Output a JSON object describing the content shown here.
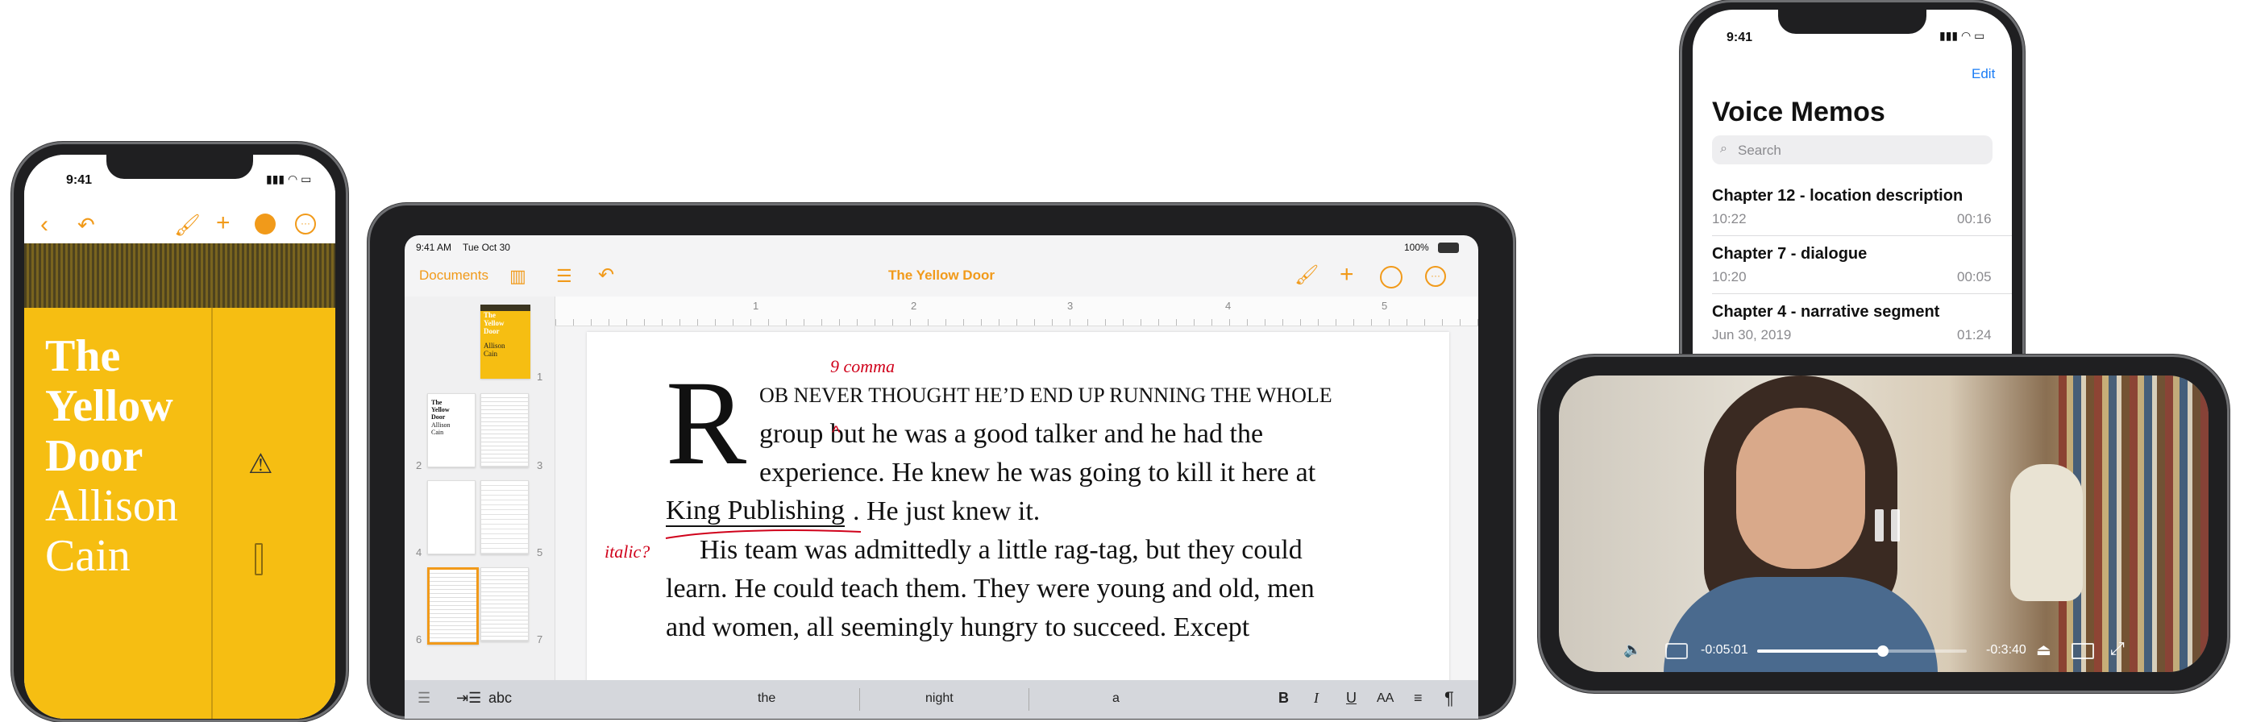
{
  "phone_left": {
    "time": "9:41",
    "cover_title_line1": "The",
    "cover_title_line2": "Yellow",
    "cover_title_line3": "Door",
    "cover_author_line1": "Allison",
    "cover_author_line2": "Cain",
    "accent": "#f19a1a",
    "cover_color": "#f6be12"
  },
  "ipad": {
    "time": "9:41 AM",
    "date": "Tue Oct 30",
    "battery": "100%",
    "documents_label": "Documents",
    "doc_title": "The Yellow Door",
    "ruler": [
      "1",
      "2",
      "3",
      "4",
      "5"
    ],
    "page_numbers": [
      "1",
      "2",
      "3",
      "4",
      "5",
      "6",
      "7"
    ],
    "thumb_title": "The Yellow Door",
    "thumb_author": "Allison Cain",
    "drop_cap": "R",
    "para1_line1": "OB NEVER THOUGHT HE’D END UP RUNNING THE WHOLE",
    "para1_line2": "group but he was a good talker and he had the",
    "para1_line3": "experience. He knew he was going to kill it here at",
    "para1_line4a": "King Publishing",
    "para1_line4b": ". He just knew it.",
    "para2_line1": "His team was admittedly a little rag-tag, but they could",
    "para2_line2": "learn. He could teach them. They were young and old, men",
    "para2_line3": "and women, all seemingly hungry to succeed. Except",
    "annotation_comma": "comma",
    "annotation_italic": "italic?",
    "keyboard": {
      "abc": "abc",
      "suggestions": [
        "the",
        "night",
        "a"
      ],
      "bold": "B",
      "italic": "I",
      "underline": "U",
      "size": "AA",
      "pilcrow": "¶"
    }
  },
  "phone_voice": {
    "time": "9:41",
    "edit_label": "Edit",
    "title": "Voice Memos",
    "search_placeholder": "Search",
    "memos": [
      {
        "title": "Chapter 12 - location description",
        "date": "10:22",
        "duration": "00:16"
      },
      {
        "title": "Chapter 7 - dialogue",
        "date": "10:20",
        "duration": "00:05"
      },
      {
        "title": "Chapter 4 - narrative segment",
        "date": "Jun 30, 2019",
        "duration": "01:24"
      }
    ]
  },
  "phone_video": {
    "elapsed": "-0:05:01",
    "remaining": "-0:3:40",
    "progress": 0.6
  }
}
